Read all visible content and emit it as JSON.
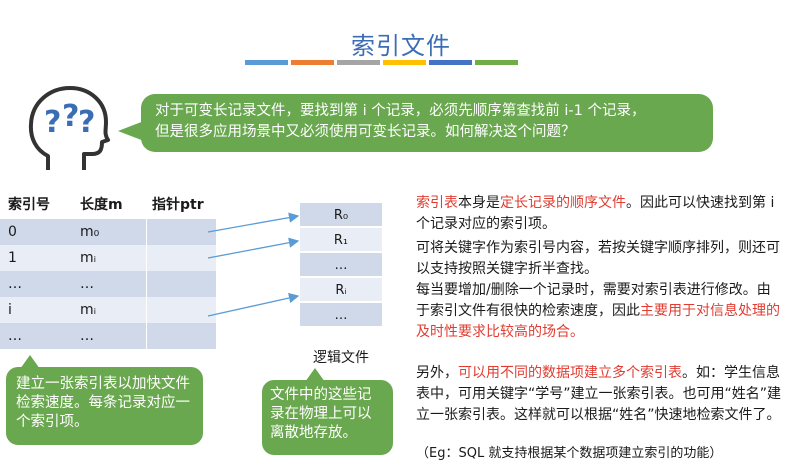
{
  "title": "索引文件",
  "accent_bars": [
    "#5b9bd5",
    "#ed7d31",
    "#a5a5a5",
    "#ffc000",
    "#4472c4",
    "#70ad47"
  ],
  "bubble": {
    "line1": "对于可变长记录文件，要找到第 i 个记录，必须先顺序第查找前 i-1 个记录，",
    "line2": "但是很多应用场景中又必须使用可变长记录。如何解决这个问题？"
  },
  "index_table": {
    "headers": [
      "索引号",
      "长度m",
      "指针ptr"
    ],
    "rows": [
      [
        "0",
        "m₀",
        ""
      ],
      [
        "1",
        "mᵢ",
        ""
      ],
      [
        "…",
        "…",
        ""
      ],
      [
        "i",
        "mᵢ",
        ""
      ],
      [
        "…",
        "…",
        ""
      ]
    ]
  },
  "logical_file": {
    "rows": [
      "R₀",
      "R₁",
      "…",
      "Rᵢ",
      "…"
    ],
    "caption": "逻辑文件"
  },
  "note_left": "建立一张索引表以加快文件检索速度。每条记录对应一个索引项。",
  "note_mid": "文件中的这些记录在物理上可以离散地存放。",
  "right_text": {
    "p1_a": "索引表",
    "p1_b": "本身是",
    "p1_c": "定长记录的顺序文件",
    "p1_d": "。因此可以快速找到第 i 个记录对应的索引项。",
    "p2": "可将关键字作为索引号内容，若按关键字顺序排列，则还可以支持按照关键字折半查找。",
    "p3_a": "每当要增加/删除一个记录时，需要对索引表进行修改。由于索引文件有很快的检索速度，因此",
    "p3_b": "主要用于对信息处理的及时性要求比较高的场合。",
    "p4_a": "另外，",
    "p4_b": "可以用不同的数据项建立多个索引表",
    "p4_c": "。如：学生信息表中，可用关键字“学号”建立一张索引表。也可用“姓名”建立一张索引表。这样就可以根据“姓名”快速地检索文件了。",
    "p5": "（Eg：SQL 就支持根据某个数据项建立索引的功能）"
  }
}
